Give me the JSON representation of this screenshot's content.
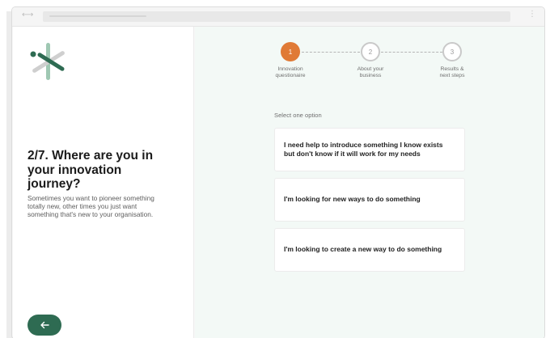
{
  "browser": {
    "back_forward_glyph": "⟷",
    "menu_glyph": "⋮"
  },
  "question": {
    "title": "2/7. Where are you in your innovation journey?",
    "description": "Sometimes you want to pioneer something totally new, other times you just want something that's new to your organisation.",
    "back_icon": "arrow-left-icon"
  },
  "steps": [
    {
      "number": "1",
      "label_line1": "Innovation",
      "label_line2": "questionaire",
      "state": "active"
    },
    {
      "number": "2",
      "label_line1": "About your",
      "label_line2": "business",
      "state": "inactive"
    },
    {
      "number": "3",
      "label_line1": "Results &",
      "label_line2": "next steps",
      "state": "inactive"
    }
  ],
  "options": {
    "prompt": "Select one option",
    "items": [
      {
        "line1": "I need help to introduce something I know exists",
        "line2": "but don't know if it will work for my needs"
      },
      {
        "line1": "I'm looking for new ways to do something",
        "line2": ""
      },
      {
        "line1": "I'm looking to create a new way to do something",
        "line2": ""
      }
    ]
  },
  "colors": {
    "brand_green": "#2e6b52",
    "active_step": "#e07a36",
    "panel_bg": "#f3f9f6"
  }
}
